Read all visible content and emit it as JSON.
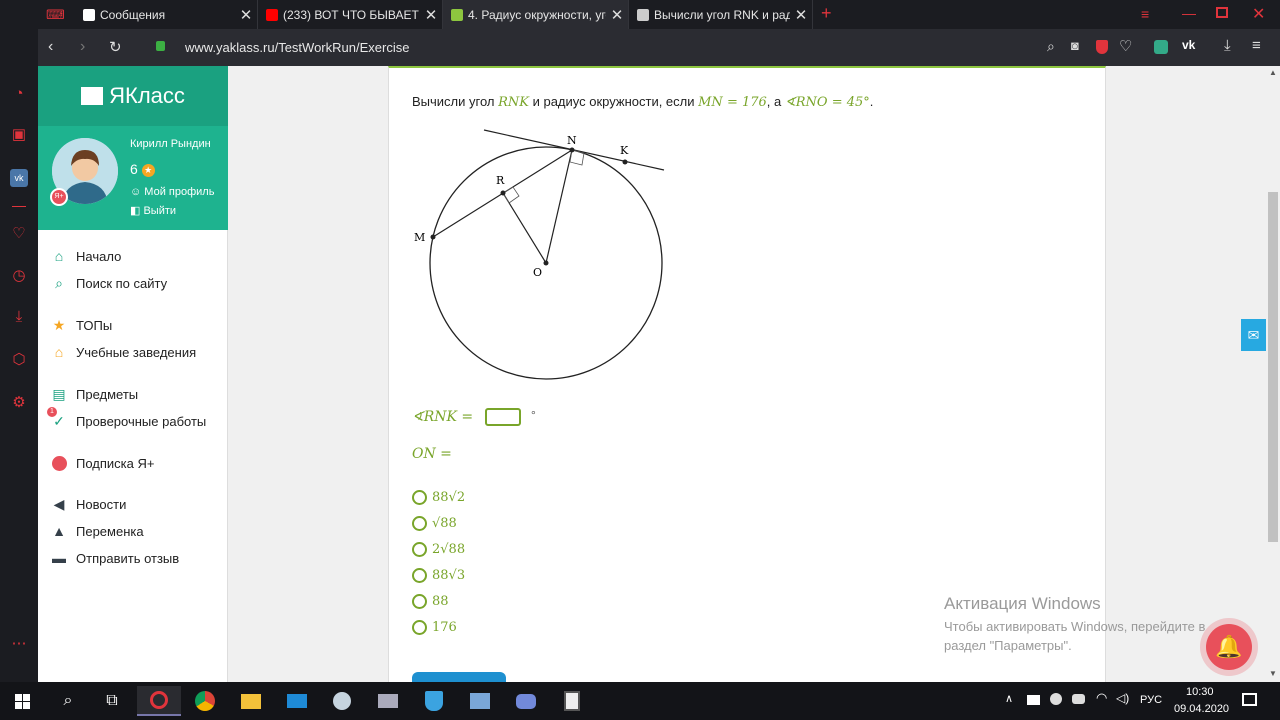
{
  "browser": {
    "tabs": [
      {
        "title": "Сообщения",
        "color": "#ffffff"
      },
      {
        "title": "(233) ВОТ ЧТО БЫВАЕТ КО",
        "color": "#ff0000"
      },
      {
        "title": "4. Радиус окружности, уго",
        "color": "#8dc63f"
      },
      {
        "title": "Вычисли угол RNK и ради",
        "color": "#cccccc"
      }
    ],
    "url": "www.yaklass.ru/TestWorkRun/Exercise",
    "new_tab": "+"
  },
  "site": {
    "logo": "ЯКласс",
    "user": {
      "name": "Кирилл Рындин",
      "score": "6",
      "profile_link": "Мой профиль",
      "logout_link": "Выйти",
      "badge": "Я+"
    },
    "menu": [
      {
        "label": "Начало",
        "icon": "home-icon"
      },
      {
        "label": "Поиск по сайту",
        "icon": "search-icon"
      },
      {
        "label": "ТОПы",
        "icon": "star-icon"
      },
      {
        "label": "Учебные заведения",
        "icon": "school-icon"
      },
      {
        "label": "Предметы",
        "icon": "book-icon"
      },
      {
        "label": "Проверочные работы",
        "icon": "check-icon",
        "badge": "1"
      },
      {
        "label": "Подписка Я+",
        "icon": "subscription-icon"
      },
      {
        "label": "Новости",
        "icon": "megaphone-icon"
      },
      {
        "label": "Переменка",
        "icon": "bell-icon"
      },
      {
        "label": "Отправить отзыв",
        "icon": "feedback-icon"
      }
    ]
  },
  "exercise": {
    "question_prefix": "Вычисли угол ",
    "angle_name": "RNK",
    "question_mid": " и радиус окружности, если ",
    "given_mn": "MN = 176",
    "question_mid2": ", а ",
    "given_angle": "∢RNO = 45°",
    "question_end": ".",
    "diagram_labels": {
      "N": "N",
      "K": "K",
      "R": "R",
      "M": "M",
      "O": "O"
    },
    "answer_label": "∢RNK =",
    "degree": "°",
    "on_label": "ON =",
    "options": [
      "88√2",
      "√88",
      "2√88",
      "88√3",
      "88",
      "176"
    ]
  },
  "watermark": {
    "title": "Активация Windows",
    "text": "Чтобы активировать Windows, перейдите в раздел \"Параметры\"."
  },
  "taskbar": {
    "lang": "РУС",
    "time": "10:30",
    "date": "09.04.2020"
  }
}
